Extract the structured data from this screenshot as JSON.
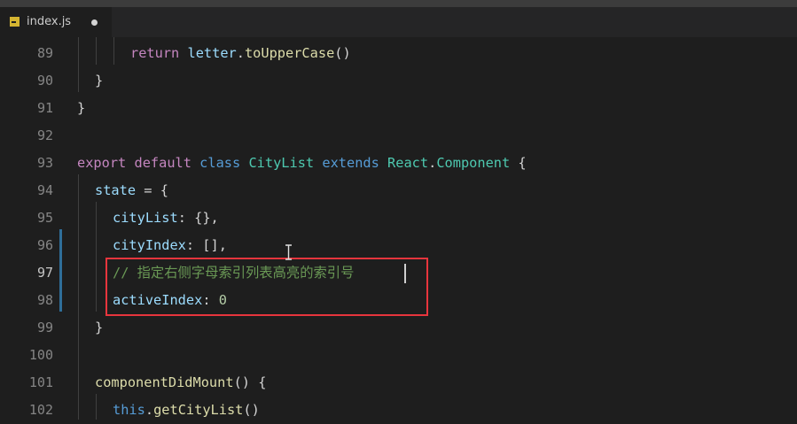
{
  "tab": {
    "filename": "index.js",
    "icon": "js-file-icon",
    "unsaved_indicator": "dot-icon"
  },
  "lines": [
    {
      "num": "89",
      "text": "return letter.toUpperCase()"
    },
    {
      "num": "90",
      "text": "}"
    },
    {
      "num": "91",
      "text": "}"
    },
    {
      "num": "92",
      "text": ""
    },
    {
      "num": "93",
      "text": "export default class CityList extends React.Component {"
    },
    {
      "num": "94",
      "text": "state = {"
    },
    {
      "num": "95",
      "text": "cityList: {},"
    },
    {
      "num": "96",
      "text": "cityIndex: [],"
    },
    {
      "num": "97",
      "text": "// 指定右侧字母索引列表高亮的索引号"
    },
    {
      "num": "98",
      "text": "activeIndex: 0"
    },
    {
      "num": "99",
      "text": "}"
    },
    {
      "num": "100",
      "text": ""
    },
    {
      "num": "101",
      "text": "componentDidMount() {"
    },
    {
      "num": "102",
      "text": "this.getCityList()"
    }
  ],
  "active_line": "97",
  "highlight_color": "#e8353d"
}
